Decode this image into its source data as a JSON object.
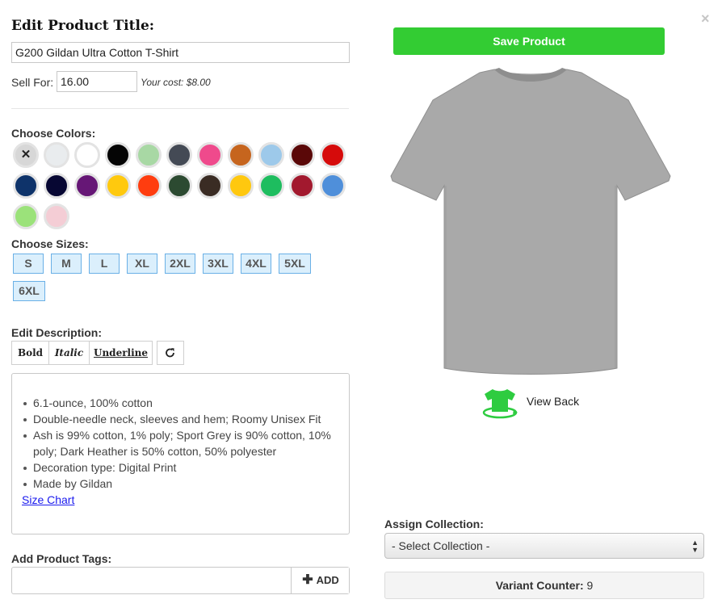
{
  "close_label": "×",
  "edit": {
    "title_label": "Edit Product Title:",
    "title_value": "G200 Gildan Ultra Cotton T-Shirt",
    "sell_for_label": "Sell For:",
    "sell_for_value": "16.00",
    "your_cost": "Your cost: $8.00"
  },
  "colors": {
    "label": "Choose Colors:",
    "swatches": [
      {
        "name": "clear",
        "color": "#d7d7d7"
      },
      {
        "name": "ash",
        "color": "#e9ecee"
      },
      {
        "name": "white",
        "color": "#ffffff"
      },
      {
        "name": "black",
        "color": "#050505"
      },
      {
        "name": "sage",
        "color": "#a8d8a4"
      },
      {
        "name": "dark-heather",
        "color": "#444a55"
      },
      {
        "name": "pink",
        "color": "#ef4a8c"
      },
      {
        "name": "texas-orange",
        "color": "#c6651e"
      },
      {
        "name": "light-blue",
        "color": "#9dc9ea"
      },
      {
        "name": "maroon",
        "color": "#5a0808"
      },
      {
        "name": "red",
        "color": "#d60b0b"
      },
      {
        "name": "navy",
        "color": "#0e336a"
      },
      {
        "name": "dark-navy",
        "color": "#070733"
      },
      {
        "name": "purple",
        "color": "#661776"
      },
      {
        "name": "gold",
        "color": "#ffc90e"
      },
      {
        "name": "orange",
        "color": "#ff3d0f"
      },
      {
        "name": "forest",
        "color": "#2c4a31"
      },
      {
        "name": "dark-chocolate",
        "color": "#3a2c24"
      },
      {
        "name": "yellow",
        "color": "#ffc80f"
      },
      {
        "name": "kelly-green",
        "color": "#1ebd5f"
      },
      {
        "name": "cardinal",
        "color": "#a2192e"
      },
      {
        "name": "carolina-blue",
        "color": "#4f8fda"
      },
      {
        "name": "lime",
        "color": "#9be27a"
      },
      {
        "name": "light-pink",
        "color": "#f4cdd5"
      }
    ],
    "clear_glyph": "✕"
  },
  "sizes": {
    "label": "Choose Sizes:",
    "items": [
      "S",
      "M",
      "L",
      "XL",
      "2XL",
      "3XL",
      "4XL",
      "5XL",
      "6XL"
    ]
  },
  "description": {
    "label": "Edit Description:",
    "toolbar": {
      "bold": "Bold",
      "italic": "Italic",
      "underline": "Underline"
    },
    "bullets": [
      "6.1-ounce, 100% cotton",
      "Double-needle neck, sleeves and hem; Roomy Unisex Fit",
      "Ash is 99% cotton, 1% poly; Sport Grey is 90% cotton, 10% poly; Dark Heather is 50% cotton, 50% polyester",
      "Decoration type: Digital Print",
      "Made by Gildan"
    ],
    "size_chart_link": "Size Chart"
  },
  "tags": {
    "label": "Add Product Tags:",
    "input_value": "",
    "add_label": "ADD"
  },
  "right": {
    "save_label": "Save Product",
    "shirt_color": "#a9a9a9",
    "view_back_label": "View Back",
    "assign_label": "Assign Collection:",
    "select_value": "- Select Collection -",
    "variant_counter_label": "Variant Counter:",
    "variant_counter_value": "9"
  },
  "accent_green": "#33cc33"
}
